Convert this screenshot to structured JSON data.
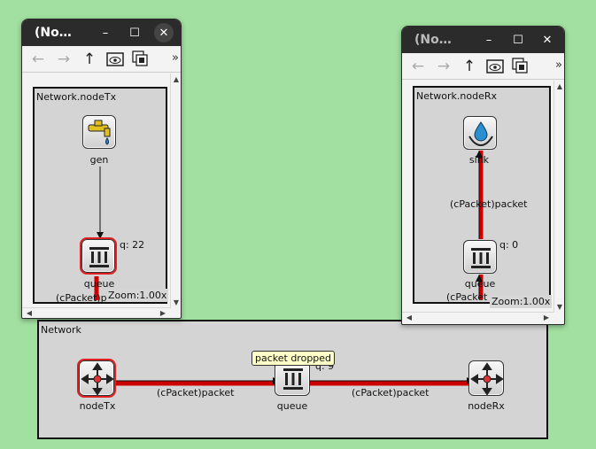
{
  "main": {
    "title": "Network",
    "nodes": {
      "nodeTx": "nodeTx",
      "queue": "queue",
      "nodeRx": "nodeRx"
    },
    "links": [
      "(cPacket)packet",
      "(cPacket)packet"
    ],
    "queue_length": "q: 9",
    "bubble": "packet dropped"
  },
  "tx_window": {
    "title": "(No…",
    "toolbar": {
      "back": "←",
      "forward": "→",
      "up": "↑",
      "overflow": "»"
    },
    "canvas_title": "Network.nodeTx",
    "nodes": {
      "gen": "gen",
      "queue": "queue"
    },
    "queue_length": "q: 22",
    "link_label": "(cPacket)p",
    "zoom": "Zoom:1.00x"
  },
  "rx_window": {
    "title": "(No…",
    "toolbar": {
      "back": "←",
      "forward": "→",
      "up": "↑",
      "overflow": "»"
    },
    "canvas_title": "Network.nodeRx",
    "nodes": {
      "sink": "sink",
      "queue": "queue"
    },
    "queue_length": "q: 0",
    "link_label": "(cPacket)packet",
    "link_label_bottom": "(cPacket",
    "zoom": "Zoom:1.00x"
  },
  "colors": {
    "background": "#a1e0a0",
    "canvas": "#d4d4d4",
    "link": "#cc0000",
    "selection": "#e02020",
    "bubble": "#ffffc8"
  },
  "icons": [
    "router-icon",
    "queue-icon",
    "faucet-icon",
    "water-drop-sink-icon",
    "arrow-left-icon",
    "arrow-right-icon",
    "arrow-up-icon",
    "eye-icon",
    "layers-icon"
  ]
}
